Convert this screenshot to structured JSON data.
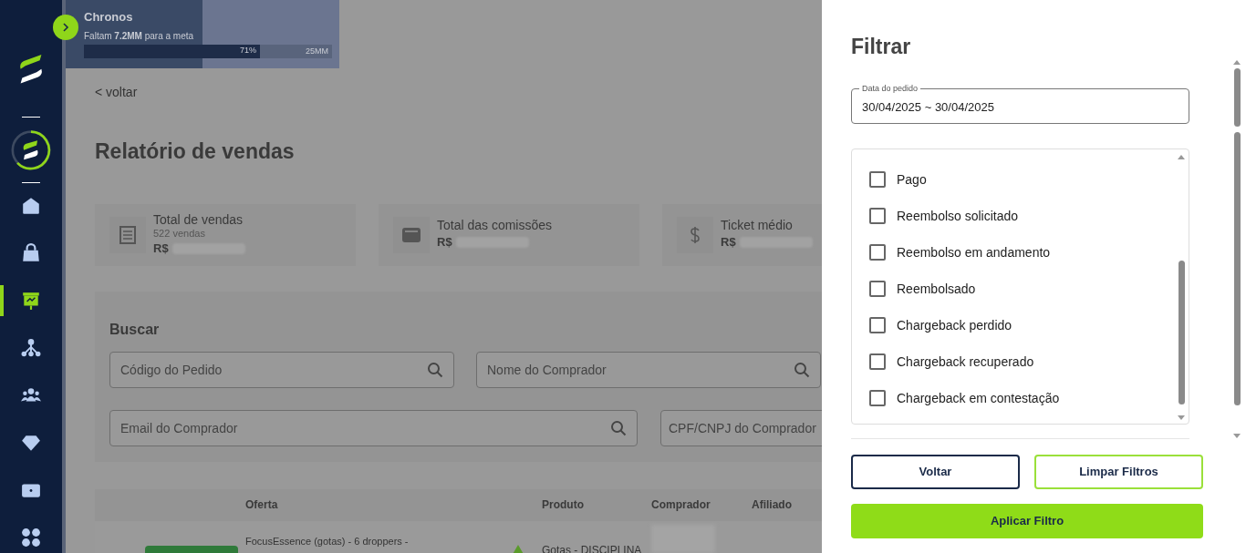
{
  "sidebar": {
    "items": [
      {
        "kind": "home",
        "selected": false
      },
      {
        "kind": "bag",
        "selected": false
      },
      {
        "kind": "board",
        "selected": true
      },
      {
        "kind": "network",
        "selected": false
      },
      {
        "kind": "people",
        "selected": false
      },
      {
        "kind": "diamond",
        "selected": false
      },
      {
        "kind": "ticket",
        "selected": false
      },
      {
        "kind": "apps",
        "selected": false
      }
    ]
  },
  "banner": {
    "title": "Chronos",
    "subtitle": "Faltam **7.2MM** para a meta",
    "level": 0.71,
    "percent": "71%",
    "goal": "25MM"
  },
  "back_link": "< voltar",
  "page_title": "Relatório de vendas",
  "stats": [
    {
      "kind": "receipt",
      "title": "Total de vendas",
      "subtitle": "522 vendas",
      "currency": "R$"
    },
    {
      "kind": "wallet",
      "title": "Total das comissões",
      "currency": "R$"
    },
    {
      "kind": "dollar",
      "title": "Ticket médio",
      "currency": "R$"
    }
  ],
  "search": {
    "title": "Buscar",
    "fields": [
      {
        "placeholder": "Código do Pedido"
      },
      {
        "placeholder": "Nome do Comprador"
      },
      {
        "placeholder": "Email do Comprador"
      },
      {
        "placeholder": "CPF/CNPJ do Comprador"
      }
    ]
  },
  "table": {
    "columns": [
      "Oferta",
      "Produto",
      "Comprador",
      "Afiliado"
    ],
    "rows": [
      {
        "offer": "FocusEssence (gotas) - 6 droppers -",
        "product": "Gotas - DISCIPLINA"
      }
    ]
  },
  "filter": {
    "title": "Filtrar",
    "date_field": {
      "label": "Data do pedido",
      "value": "30/04/2025 ~ 30/04/2025"
    },
    "status_options": [
      {
        "label": "Pago",
        "checked": false
      },
      {
        "label": "Reembolso solicitado",
        "checked": false
      },
      {
        "label": "Reembolso em andamento",
        "checked": false
      },
      {
        "label": "Reembolsado",
        "checked": false
      },
      {
        "label": "Chargeback perdido",
        "checked": false
      },
      {
        "label": "Chargeback recuperado",
        "checked": false
      },
      {
        "label": "Chargeback em contestação",
        "checked": false
      }
    ],
    "buttons": [
      {
        "kind": "outline",
        "label": "Voltar"
      },
      {
        "kind": "accent",
        "label": "Limpar Filtros"
      },
      {
        "kind": "primary",
        "label": "Aplicar Filtro"
      }
    ]
  }
}
